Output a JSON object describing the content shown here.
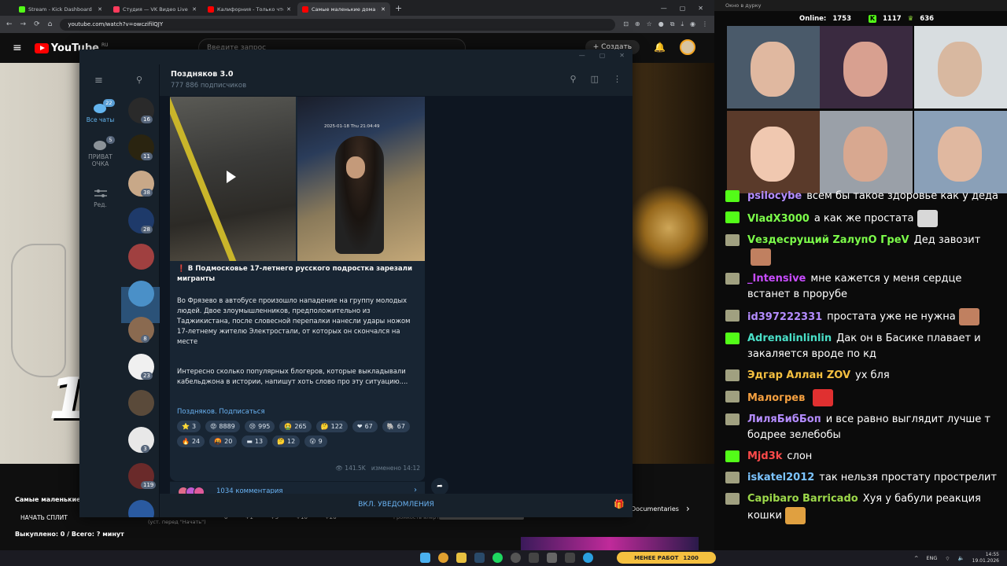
{
  "browser": {
    "tabs": [
      {
        "label": "Stream - Kick Dashboard",
        "color": "#53fc18",
        "active": false
      },
      {
        "label": "Студия — VK Видео Live",
        "color": "#ff3b5c",
        "active": false
      },
      {
        "label": "Калифорния - Только что ед...",
        "color": "#ff0000",
        "active": false
      },
      {
        "label": "Самые маленькие дома в мир...",
        "color": "#ff0000",
        "active": true
      }
    ],
    "url": "youtube.com/watch?v=owczifilQJY"
  },
  "youtube": {
    "logo": "YouTube",
    "region": "RU",
    "search_placeholder": "Введите запрос",
    "create_label": "Создать",
    "video_overlay_number": "1",
    "video_title": "Самые маленькие д",
    "split_label": "НАЧАТЬ СПЛИТ",
    "split_hint": "(уст. перед \"Начать\")",
    "steps": [
      "0",
      "+1",
      "+5",
      "+10",
      "+20"
    ],
    "alert_label": "Громкость алерта:",
    "status": "Выкуплено: 0 / Всего: ? минут",
    "side_label": "Documentaries"
  },
  "telegram": {
    "rail": {
      "all_chats": {
        "label": "Все чаты",
        "badge": "22"
      },
      "private": {
        "label": "ПРИВАТ\nОЧКА",
        "line1": "ПРИВАТ",
        "line2": "ОЧКА",
        "badge": "5"
      },
      "edit": {
        "label": "Ред."
      }
    },
    "chats": [
      {
        "badge": "16",
        "color": "#2a2a2a"
      },
      {
        "badge": "11",
        "color": "#2a2410"
      },
      {
        "badge": "38",
        "color": "#c8a888"
      },
      {
        "badge": "28",
        "color": "#1e3a6a"
      },
      {
        "badge": "",
        "color": "#a04040"
      },
      {
        "badge": "",
        "color": "#4a90c8"
      },
      {
        "badge": "8",
        "color": "#8a6a50"
      },
      {
        "badge": "23",
        "color": "#f0f0f0"
      },
      {
        "badge": "",
        "color": "#5a4a3a"
      },
      {
        "badge": "3",
        "color": "#e8e8e8"
      },
      {
        "badge": "119",
        "color": "#6a2a2a"
      },
      {
        "badge": "",
        "color": "#2a5aa0"
      }
    ],
    "channel": {
      "name": "Поздняков 3.0",
      "subscribers": "777 886 подписчиков"
    },
    "post": {
      "media_stamp": "2025-01-18 Thu 21:04:49",
      "title": "❗️ В Подмосковье 17-летнего русского подростка зарезали мигранты",
      "body1": "Во Фрязево в автобусе произошло нападение на группу молодых людей. Двое злоумышленников, предположительно из Таджикистана, после словесной перепалки нанесли удары ножом 17-летнему жителю Электростали, от которых он скончался на месте",
      "body2": "Интересно сколько популярных блогеров, которые выкладывали кабельджона в истории, напишут хоть слово про эту ситуацию....",
      "link": "Поздняков. Подписаться",
      "reactions": [
        {
          "emoji": "⭐",
          "count": "3"
        },
        {
          "emoji": "😡",
          "count": "8889"
        },
        {
          "emoji": "😢",
          "count": "995"
        },
        {
          "emoji": "🤮",
          "count": "265"
        },
        {
          "emoji": "🤔",
          "count": "122"
        },
        {
          "emoji": "❤",
          "count": "67"
        },
        {
          "emoji": "🐘",
          "count": "67"
        },
        {
          "emoji": "🔥",
          "count": "24"
        },
        {
          "emoji": "🤬",
          "count": "20"
        },
        {
          "emoji": "▬",
          "count": "13"
        },
        {
          "emoji": "🤔",
          "count": "12"
        },
        {
          "emoji": "😮",
          "count": "9"
        }
      ],
      "views": "141.5K",
      "edited": "изменено 14:12",
      "comments": "1034 комментария"
    },
    "notifications_button": "ВКЛ. УВЕДОМЛЕНИЯ"
  },
  "stream": {
    "window_title": "Окно в дурку",
    "online_label": "Online:",
    "online_count": "1753",
    "kick_count": "1117",
    "vk_count": "636",
    "messages": [
      {
        "nick": "psilocybe",
        "text": "всем бы такое здоровье как у деда",
        "nick_color": "#b48cff",
        "badge_color": "#53fc18",
        "emote": ""
      },
      {
        "nick": "VladX3000",
        "text": "а как же простата",
        "nick_color": "#7cfc4a",
        "badge_color": "#53fc18",
        "emote": "#d8d8d8"
      },
      {
        "nick": "Vездесрущий ZалупО ГреV",
        "text": "Дед завозит",
        "nick_color": "#7cfc4a",
        "badge_color": "#a0a080",
        "emote": "#c08060"
      },
      {
        "nick": "_Intensive",
        "text": "мне кажется у меня сердце встанет в прорубе",
        "nick_color": "#c84cff",
        "badge_color": "#a0a080",
        "emote": ""
      },
      {
        "nick": "id397222331",
        "text": "простата уже не нужна",
        "nick_color": "#b48cff",
        "badge_color": "#a0a080",
        "emote": "#c08060"
      },
      {
        "nick": "Adrenalinlinlin",
        "text": "Дак он в Басике плавает и закаляется вроде по кд",
        "nick_color": "#4ae0c8",
        "badge_color": "#53fc18",
        "emote": ""
      },
      {
        "nick": "Эдгар Аллан ZOV",
        "text": "ух бля",
        "nick_color": "#f5c040",
        "badge_color": "#a0a080",
        "emote": ""
      },
      {
        "nick": "Малогрев",
        "text": "",
        "nick_color": "#f5a040",
        "badge_color": "#a0a080",
        "emote": "#e03030"
      },
      {
        "nick": "ЛиляБибБоп",
        "text": "и все равно выглядит лучше т бодрее зелебобы",
        "nick_color": "#b48cff",
        "badge_color": "#a0a080",
        "emote": ""
      },
      {
        "nick": "Mjd3k",
        "text": "слон",
        "nick_color": "#ff4a4a",
        "badge_color": "#53fc18",
        "emote": ""
      },
      {
        "nick": "iskatel2012",
        "text": "так нельзя простату прострелит",
        "nick_color": "#7cc4ff",
        "badge_color": "#a0a080",
        "emote": ""
      },
      {
        "nick": "Capibaro Barricado",
        "text": "Хуя у бабули реакция кошки",
        "nick_color": "#9cd84a",
        "badge_color": "#a0a080",
        "emote": "#e0a040"
      }
    ]
  },
  "taskbar": {
    "promo": "МЕНЕЕ РАБОТ",
    "promo_num": "1200",
    "lang": "ENG",
    "time": "14:55",
    "date": "19.01.2026"
  }
}
